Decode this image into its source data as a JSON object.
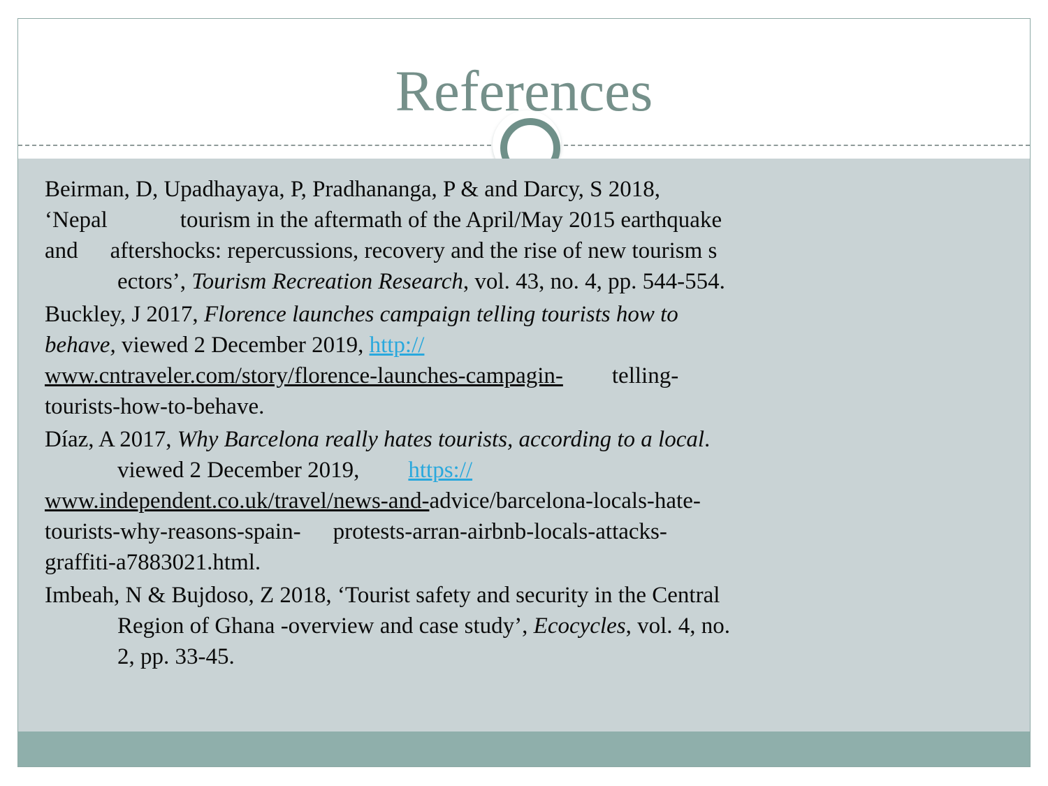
{
  "slide": {
    "title": "References",
    "accent_color": "#75908a",
    "body_bg_color": "#c9d3d5",
    "band_color": "#8fafab",
    "link_color": "#29a8dd",
    "ornament_name": "circle-ring-ornament"
  },
  "references": [
    {
      "id": "beirman-2018",
      "lines": [
        {
          "segments": [
            {
              "text": "Beirman, D, Upadhayaya, P, Pradhananga, P & and Darcy, S 2018,"
            }
          ]
        },
        {
          "segments": [
            {
              "text": "‘Nepal"
            },
            {
              "tab": "tab"
            },
            {
              "text": "tourism in the aftermath of the April/May 2015 earthquake"
            }
          ]
        },
        {
          "segments": [
            {
              "text": "and"
            },
            {
              "tab": "tab-xs"
            },
            {
              "text": "aftershocks: repercussions, recovery and the rise of new tourism s"
            }
          ]
        },
        {
          "segments": [
            {
              "tab": "tab"
            },
            {
              "text": "ectors’, "
            },
            {
              "text": "Tourism Recreation Research",
              "style": "italic"
            },
            {
              "text": ", vol. 43, no. 4, pp. 544-554."
            }
          ]
        }
      ]
    },
    {
      "id": "buckley-2017",
      "lines": [
        {
          "segments": [
            {
              "text": "Buckley, J 2017, "
            },
            {
              "text": "Florence launches campaign telling tourists how to",
              "style": "italic"
            }
          ]
        },
        {
          "segments": [
            {
              "text": "behave,",
              "style": "italic"
            },
            {
              "text": " viewed 2 December 2019,  "
            },
            {
              "text": "http://",
              "style": "link-blue"
            }
          ]
        },
        {
          "segments": [
            {
              "text": "www.cntraveler.com/story/florence-launches-campagin-",
              "style": "link-dark"
            },
            {
              "tab": "tab-sm"
            },
            {
              "text": "telling-"
            }
          ]
        },
        {
          "segments": [
            {
              "text": "tourists-how-to-behave."
            }
          ]
        }
      ]
    },
    {
      "id": "diaz-2017",
      "lines": [
        {
          "segments": [
            {
              "text": "Díaz, A 2017, "
            },
            {
              "text": "Why Barcelona really hates tourists, according to a local",
              "style": "italic"
            },
            {
              "text": "."
            }
          ]
        },
        {
          "segments": [
            {
              "tab": "tab"
            },
            {
              "text": "viewed 2 December 2019,"
            },
            {
              "tab": "tab-sm"
            },
            {
              "text": "https://",
              "style": "link-blue"
            }
          ]
        },
        {
          "segments": [
            {
              "text": "www.independent.co.uk/travel/news-and-",
              "style": "link-dark"
            },
            {
              "text": "advice/barcelona-locals-hate-"
            }
          ]
        },
        {
          "segments": [
            {
              "text": "tourists-why-reasons-spain-"
            },
            {
              "tab": "tab-xs"
            },
            {
              "text": "protests-arran-airbnb-locals-attacks-"
            }
          ]
        },
        {
          "segments": [
            {
              "text": "graffiti-a7883021.html."
            }
          ]
        }
      ]
    },
    {
      "id": "imbeah-2018",
      "lines": [
        {
          "segments": [
            {
              "text": "Imbeah, N & Bujdoso, Z 2018, ‘Tourist safety and security in the Central"
            }
          ]
        },
        {
          "segments": [
            {
              "tab": "tab"
            },
            {
              "text": "Region of Ghana -overview and case study’,  "
            },
            {
              "text": "Ecocycles",
              "style": "italic"
            },
            {
              "text": ", vol. 4, no."
            }
          ]
        },
        {
          "segments": [
            {
              "tab": "tab"
            },
            {
              "text": "2, pp. 33-45."
            }
          ]
        }
      ]
    }
  ]
}
